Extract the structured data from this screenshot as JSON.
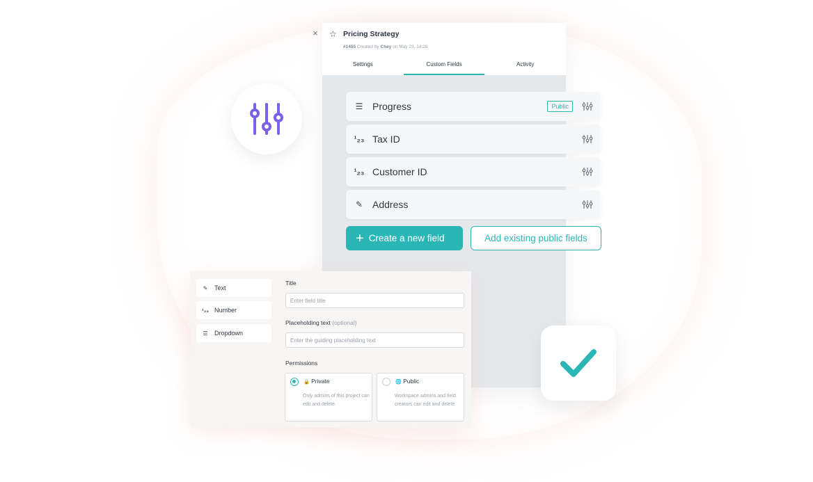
{
  "panel": {
    "close_glyph": "×",
    "star_glyph": "☆",
    "title": "Pricing Strategy",
    "meta": {
      "id": "#1455",
      "created_by_label": "Created by",
      "creator": "Chey",
      "on_label": "on",
      "date": "May 23, 14:28"
    },
    "tabs": [
      {
        "label": "Settings",
        "active": false
      },
      {
        "label": "Custom Fields",
        "active": true
      },
      {
        "label": "Activity",
        "active": false
      }
    ]
  },
  "fields": [
    {
      "icon": "list-icon",
      "label": "Progress",
      "badge": "Public"
    },
    {
      "icon": "number-icon",
      "label": "Tax ID",
      "badge": ""
    },
    {
      "icon": "number-icon",
      "label": "Customer ID",
      "badge": ""
    },
    {
      "icon": "pencil-icon",
      "label": "Address",
      "badge": ""
    }
  ],
  "field_icon_glyphs": {
    "list": "☰",
    "number": "¹₂₃",
    "pencil": "✎"
  },
  "buttons": {
    "create": "Create a new field",
    "create_icon": "+",
    "add_existing": "Add existing public fields"
  },
  "form": {
    "types": [
      {
        "icon": "pencil-icon",
        "glyph": "✎",
        "label": "Text"
      },
      {
        "icon": "number-icon",
        "glyph": "¹₂₃",
        "label": "Number"
      },
      {
        "icon": "list-icon",
        "glyph": "☰",
        "label": "Dropdown"
      }
    ],
    "title_label": "Title",
    "title_placeholder": "Enter field title",
    "placeholder_label": "Placeholding text",
    "placeholder_optional": "(optional)",
    "placeholder_placeholder": "Enter the guiding placeholding text",
    "permissions_label": "Permissions",
    "permissions": [
      {
        "icon": "lock-icon",
        "glyph": "🔒",
        "label": "Private",
        "desc": "Only admins of this project can edit and delete.",
        "selected": true
      },
      {
        "icon": "globe-icon",
        "glyph": "🌐",
        "label": "Public",
        "desc": "Workspace admins and field creators can edit and delete",
        "selected": false
      }
    ]
  },
  "colors": {
    "accent": "#2bb6b6",
    "sliders": "#7b61e8"
  }
}
